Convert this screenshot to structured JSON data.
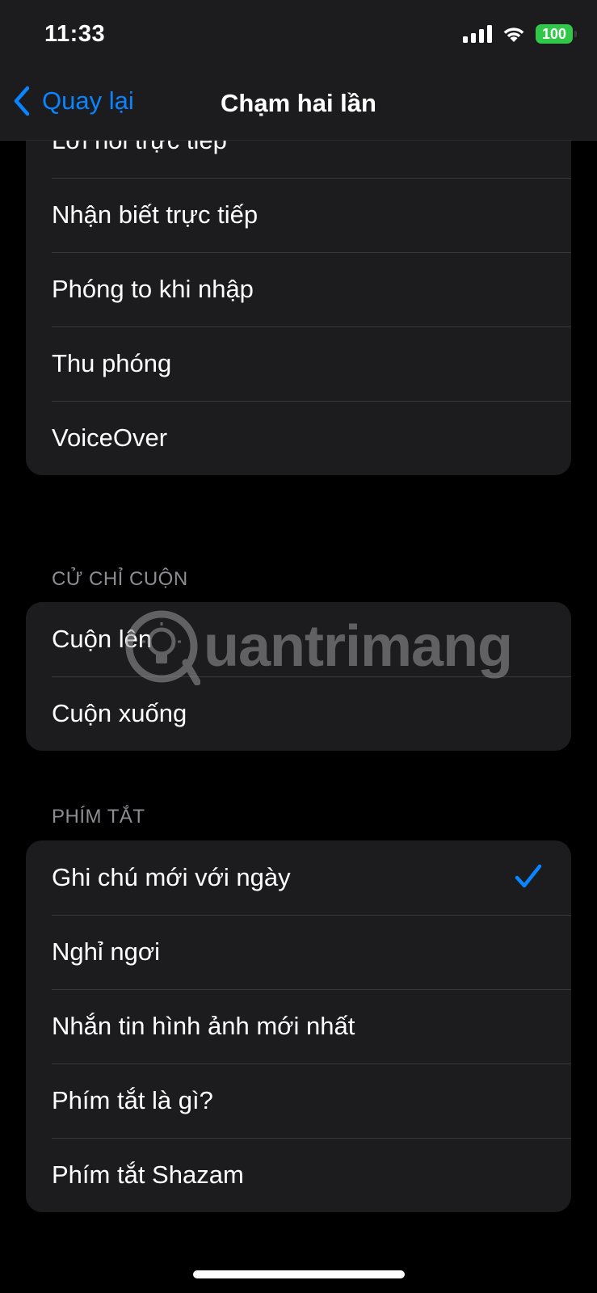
{
  "status_bar": {
    "time": "11:33",
    "battery": "100",
    "icons": [
      "signal-icon",
      "wifi-icon",
      "battery-icon"
    ],
    "battery_color": "#31c84a"
  },
  "nav": {
    "back_label": "Quay lại",
    "title": "Chạm hai lần",
    "accent_color": "#0a84ff"
  },
  "groups": {
    "top": {
      "items": [
        {
          "label": "Lời nói trực tiếp"
        },
        {
          "label": "Nhận biết trực tiếp"
        },
        {
          "label": "Phóng to khi nhập"
        },
        {
          "label": "Thu phóng"
        },
        {
          "label": "VoiceOver"
        }
      ]
    },
    "scroll": {
      "header": "CỬ CHỈ CUỘN",
      "items": [
        {
          "label": "Cuộn lên"
        },
        {
          "label": "Cuộn xuống"
        }
      ]
    },
    "shortcuts": {
      "header": "PHÍM TẮT",
      "items": [
        {
          "label": "Ghi chú mới với ngày",
          "selected": true
        },
        {
          "label": "Nghỉ ngơi"
        },
        {
          "label": "Nhắn tin hình ảnh mới nhất"
        },
        {
          "label": "Phím tắt là gì?"
        },
        {
          "label": "Phím tắt Shazam"
        }
      ]
    }
  },
  "watermark": {
    "text": "uantrimang"
  }
}
